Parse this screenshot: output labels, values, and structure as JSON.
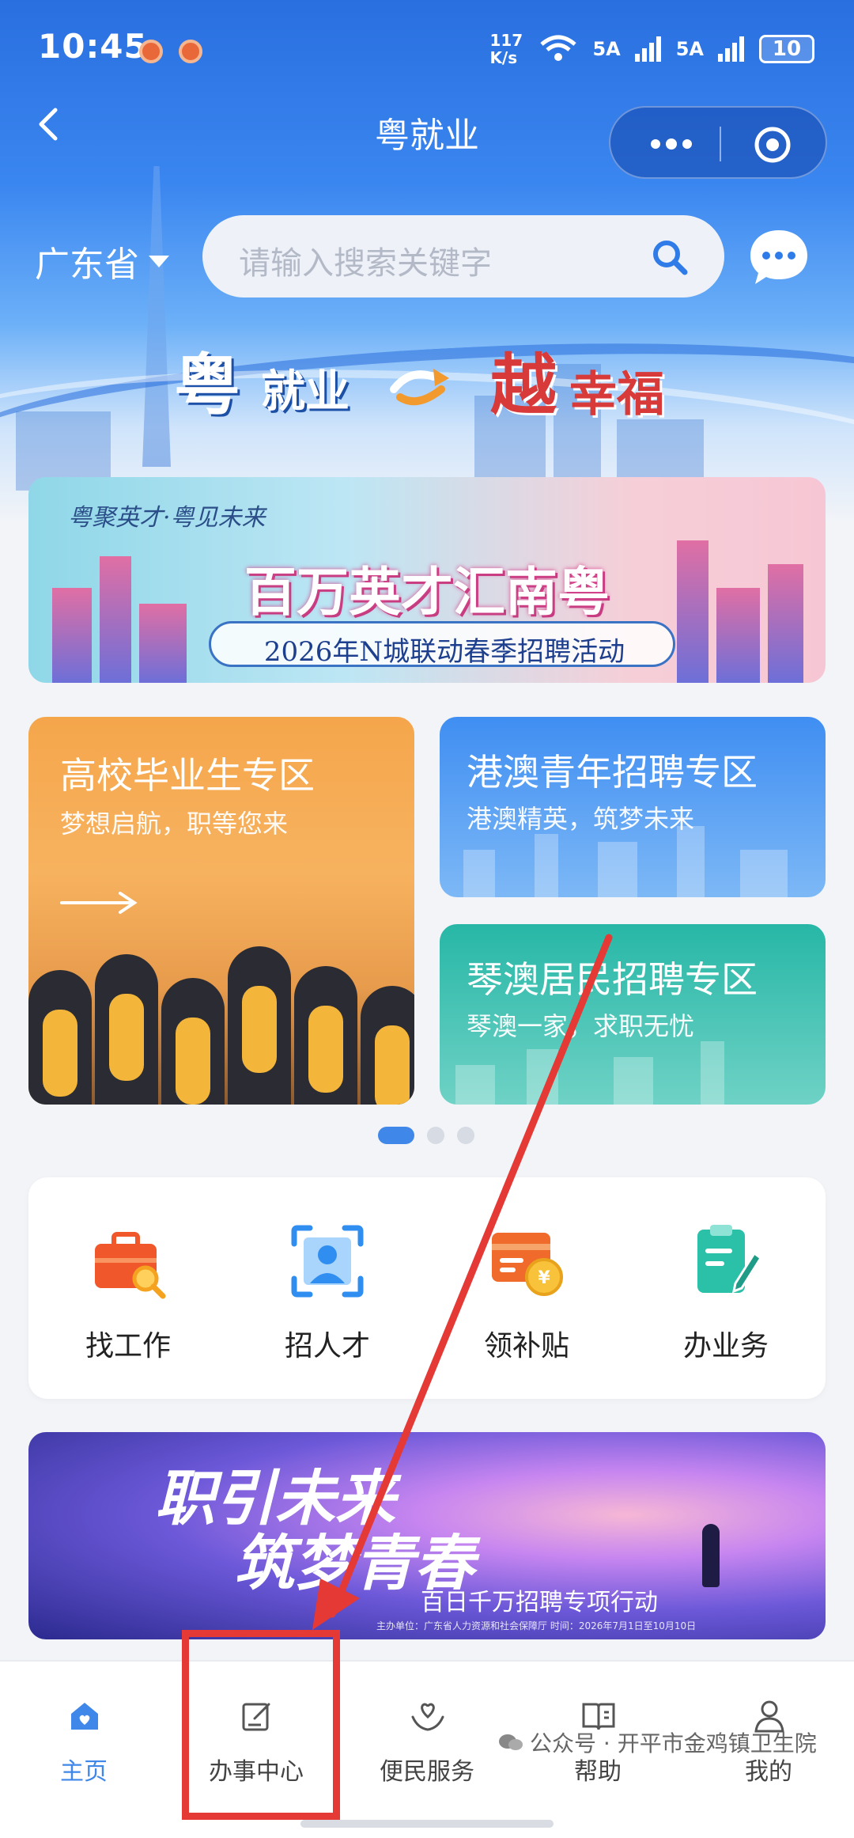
{
  "status_bar": {
    "time": "10:45",
    "net_speed": "117 K/s",
    "signal1": "5A",
    "signal2": "5A",
    "battery": "10"
  },
  "nav": {
    "title": "粤就业"
  },
  "search": {
    "region": "广东省",
    "placeholder": "请输入搜索关键字"
  },
  "hero": {
    "slogan_part1": "粤",
    "slogan_part2": "就业",
    "slogan_part3": "越",
    "slogan_part4": "幸福"
  },
  "banner1": {
    "top": "粤聚英才·粤见未来",
    "title": "百万英才汇南粤",
    "subtitle": "2026年N城联动春季招聘活动"
  },
  "zones": [
    {
      "title": "高校毕业生专区",
      "subtitle": "梦想启航，职等您来"
    },
    {
      "title": "港澳青年招聘专区",
      "subtitle": "港澳精英，筑梦未来"
    },
    {
      "title": "琴澳居民招聘专区",
      "subtitle": "琴澳一家，求职无忧"
    }
  ],
  "carousel": {
    "pages": 3,
    "active": 1
  },
  "services": [
    {
      "label": "找工作",
      "icon": "briefcase-search-icon",
      "color": "#f0572b"
    },
    {
      "label": "招人才",
      "icon": "person-scan-icon",
      "color": "#2f8ef0"
    },
    {
      "label": "领补贴",
      "icon": "subsidy-card-icon",
      "color": "#f06a2b"
    },
    {
      "label": "办业务",
      "icon": "document-edit-icon",
      "color": "#2bc0a8"
    }
  ],
  "banner2": {
    "line1": "职引未来",
    "line2": "筑梦青春",
    "subtitle": "百日千万招聘专项行动",
    "footer": "主办单位：广东省人力资源和社会保障厅    时间：2026年7月1日至10月10日"
  },
  "tabs": [
    {
      "label": "主页",
      "icon": "home-icon",
      "active": true
    },
    {
      "label": "办事中心",
      "icon": "edit-icon",
      "active": false
    },
    {
      "label": "便民服务",
      "icon": "heart-hands-icon",
      "active": false
    },
    {
      "label": "帮助",
      "icon": "book-icon",
      "active": false
    },
    {
      "label": "我的",
      "icon": "user-icon",
      "active": false
    }
  ],
  "watermark": "公众号 · 开平市金鸡镇卫生院",
  "colors": {
    "primary": "#2a6fe0",
    "accent_red": "#e53935",
    "tab_active": "#3f87e8"
  }
}
